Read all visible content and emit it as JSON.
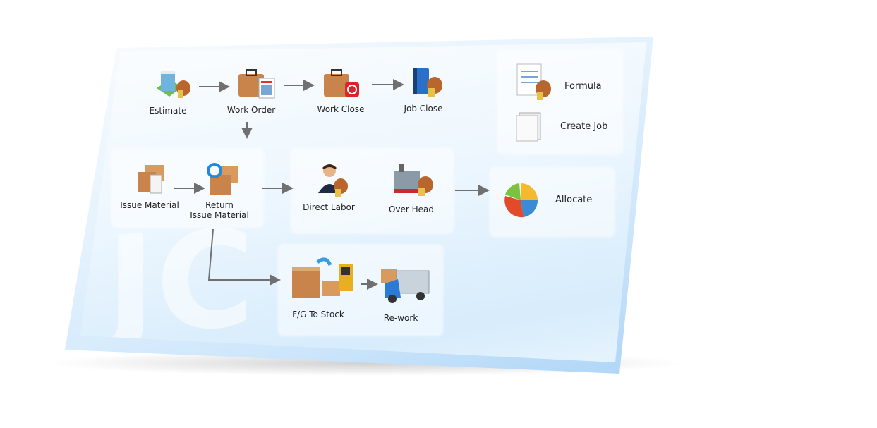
{
  "watermark": "JC",
  "nodes": {
    "estimate": "Estimate",
    "work_order": "Work Order",
    "work_close": "Work Close",
    "job_close": "Job Close",
    "formula": "Formula",
    "create_job": "Create Job",
    "issue_material": "Issue Material",
    "return_issue_material_1": "Return",
    "return_issue_material_2": "Issue Material",
    "direct_labor": "Direct Labor",
    "over_head": "Over Head",
    "allocate": "Allocate",
    "fg_to_stock": "F/G To Stock",
    "rework": "Re-work"
  },
  "colors": {
    "panel_blue": "#5aaef0",
    "arrow": "#707070",
    "box_brown": "#c8844a",
    "money_bag": "#b8662c"
  }
}
